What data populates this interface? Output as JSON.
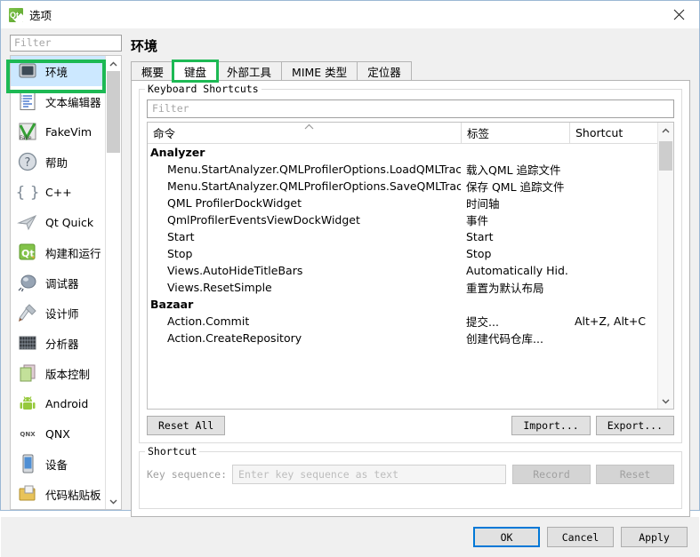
{
  "window": {
    "title": "选项",
    "logo_icon": "qt-logo-icon",
    "close_icon": "close-icon"
  },
  "sidebar": {
    "filter_placeholder": "Filter",
    "items": [
      {
        "label": "环境",
        "icon": "environment-icon",
        "selected": true
      },
      {
        "label": "文本编辑器",
        "icon": "text-editor-icon",
        "selected": false
      },
      {
        "label": "FakeVim",
        "icon": "fakevim-icon",
        "selected": false
      },
      {
        "label": "帮助",
        "icon": "help-icon",
        "selected": false
      },
      {
        "label": "C++",
        "icon": "cplusplus-icon",
        "selected": false
      },
      {
        "label": "Qt Quick",
        "icon": "qtquick-icon",
        "selected": false
      },
      {
        "label": "构建和运行",
        "icon": "build-and-run-icon",
        "selected": false
      },
      {
        "label": "调试器",
        "icon": "debugger-icon",
        "selected": false
      },
      {
        "label": "设计师",
        "icon": "designer-icon",
        "selected": false
      },
      {
        "label": "分析器",
        "icon": "analyzer-icon",
        "selected": false
      },
      {
        "label": "版本控制",
        "icon": "version-control-icon",
        "selected": false
      },
      {
        "label": "Android",
        "icon": "android-icon",
        "selected": false
      },
      {
        "label": "QNX",
        "icon": "qnx-icon",
        "selected": false
      },
      {
        "label": "设备",
        "icon": "devices-icon",
        "selected": false
      },
      {
        "label": "代码粘贴板",
        "icon": "code-paster-icon",
        "selected": false
      }
    ],
    "scroll_up_icon": "chevron-up-icon",
    "scroll_down_icon": "chevron-down-icon"
  },
  "main": {
    "page_title": "环境",
    "tabs": [
      {
        "label": "概要",
        "active": false,
        "annotated": false
      },
      {
        "label": "键盘",
        "active": true,
        "annotated": true
      },
      {
        "label": "外部工具",
        "active": false,
        "annotated": false
      },
      {
        "label": "MIME 类型",
        "active": false,
        "annotated": false
      },
      {
        "label": "定位器",
        "active": false,
        "annotated": false
      }
    ],
    "keyboard_group": {
      "title": "Keyboard Shortcuts",
      "filter_placeholder": "Filter",
      "columns": [
        {
          "label": "命令",
          "sorted": true
        },
        {
          "label": "标签",
          "sorted": false
        },
        {
          "label": "Shortcut",
          "sorted": false
        }
      ],
      "sort_indicator_icon": "sort-ascending-icon",
      "rows": [
        {
          "group": true,
          "command": "Analyzer",
          "label": "",
          "shortcut": ""
        },
        {
          "group": false,
          "command": "Menu.StartAnalyzer.QMLProfilerOptions.LoadQMLTrace",
          "label": "载入QML 追踪文件",
          "shortcut": ""
        },
        {
          "group": false,
          "command": "Menu.StartAnalyzer.QMLProfilerOptions.SaveQMLTrace",
          "label": "保存 QML 追踪文件",
          "shortcut": ""
        },
        {
          "group": false,
          "command": "QML ProfilerDockWidget",
          "label": "时间轴",
          "shortcut": ""
        },
        {
          "group": false,
          "command": "QmlProfilerEventsViewDockWidget",
          "label": "事件",
          "shortcut": ""
        },
        {
          "group": false,
          "command": "Start",
          "label": "Start",
          "shortcut": ""
        },
        {
          "group": false,
          "command": "Stop",
          "label": "Stop",
          "shortcut": ""
        },
        {
          "group": false,
          "command": "Views.AutoHideTitleBars",
          "label": "Automatically Hid...",
          "shortcut": ""
        },
        {
          "group": false,
          "command": "Views.ResetSimple",
          "label": "重置为默认布局",
          "shortcut": ""
        },
        {
          "group": true,
          "command": "Bazaar",
          "label": "",
          "shortcut": ""
        },
        {
          "group": false,
          "command": "Action.Commit",
          "label": "提交...",
          "shortcut": "Alt+Z, Alt+C"
        },
        {
          "group": false,
          "command": "Action.CreateRepository",
          "label": "创建代码仓库...",
          "shortcut": ""
        }
      ],
      "buttons": {
        "reset_all": "Reset All",
        "import": "Import...",
        "export": "Export..."
      },
      "scroll_up_icon": "chevron-up-icon",
      "scroll_down_icon": "chevron-down-icon"
    },
    "shortcut_group": {
      "title": "Shortcut",
      "key_sequence_label": "Key sequence:",
      "key_sequence_placeholder": "Enter key sequence as text",
      "key_sequence_value": "",
      "record_button": "Record",
      "reset_button": "Reset"
    }
  },
  "footer": {
    "ok": "OK",
    "cancel": "Cancel",
    "apply": "Apply"
  },
  "colors": {
    "annotation": "#1db954",
    "selection": "#cce8ff",
    "default_button_border": "#0078d7"
  }
}
